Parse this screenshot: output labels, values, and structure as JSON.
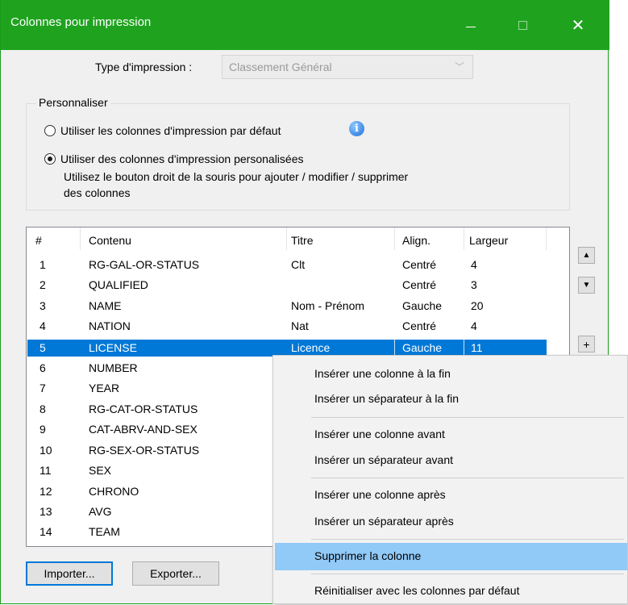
{
  "window": {
    "title": "Colonnes pour impression",
    "minimize_glyph": "—",
    "close_glyph": "✕"
  },
  "print_type": {
    "label": "Type d'impression :",
    "value": "Classement Général"
  },
  "personalize": {
    "legend": "Personnaliser",
    "option_default": "Utiliser les colonnes d'impression par défaut",
    "option_custom": "Utiliser des colonnes d'impression personalisées",
    "help_line1": "Utilisez le bouton droit de la souris pour ajouter / modifier / supprimer",
    "help_line2": "des colonnes",
    "selected": "custom"
  },
  "columns_list": {
    "headers": [
      "#",
      "Contenu",
      "Titre",
      "Align.",
      "Largeur"
    ],
    "rows": [
      {
        "num": "1",
        "contenu": "RG-GAL-OR-STATUS",
        "titre": "Clt",
        "align": "Centré",
        "largeur": "4"
      },
      {
        "num": "2",
        "contenu": "QUALIFIED",
        "titre": "",
        "align": "Centré",
        "largeur": "3"
      },
      {
        "num": "3",
        "contenu": "NAME",
        "titre": "Nom - Prénom",
        "align": "Gauche",
        "largeur": "20"
      },
      {
        "num": "4",
        "contenu": "NATION",
        "titre": "Nat",
        "align": "Centré",
        "largeur": "4"
      },
      {
        "num": "5",
        "contenu": "LICENSE",
        "titre": "Licence",
        "align": "Gauche",
        "largeur": "11"
      },
      {
        "num": "6",
        "contenu": "NUMBER",
        "titre": "",
        "align": "",
        "largeur": ""
      },
      {
        "num": "7",
        "contenu": "YEAR",
        "titre": "",
        "align": "",
        "largeur": ""
      },
      {
        "num": "8",
        "contenu": "RG-CAT-OR-STATUS",
        "titre": "",
        "align": "",
        "largeur": ""
      },
      {
        "num": "9",
        "contenu": "CAT-ABRV-AND-SEX",
        "titre": "",
        "align": "",
        "largeur": ""
      },
      {
        "num": "10",
        "contenu": "RG-SEX-OR-STATUS",
        "titre": "",
        "align": "",
        "largeur": ""
      },
      {
        "num": "11",
        "contenu": "SEX",
        "titre": "",
        "align": "",
        "largeur": ""
      },
      {
        "num": "12",
        "contenu": "CHRONO",
        "titre": "",
        "align": "",
        "largeur": ""
      },
      {
        "num": "13",
        "contenu": "AVG",
        "titre": "",
        "align": "",
        "largeur": ""
      },
      {
        "num": "14",
        "contenu": "TEAM",
        "titre": "",
        "align": "",
        "largeur": ""
      }
    ],
    "selected_row": "5"
  },
  "side_buttons": {
    "up_glyph": "▲",
    "down_glyph": "▼",
    "add_glyph": "+"
  },
  "buttons": {
    "import": "Importer...",
    "export": "Exporter..."
  },
  "context_menu": {
    "items": [
      "Insérer une colonne à la fin",
      "Insérer un séparateur à la fin",
      "Insérer une colonne avant",
      "Insérer un séparateur avant",
      "Insérer une colonne après",
      "Insérer un séparateur après",
      "Supprimer la colonne",
      "Réinitialiser avec les colonnes par défaut"
    ],
    "highlighted": "Supprimer la colonne"
  },
  "colors": {
    "titlebar": "#1fa31f",
    "selection": "#0078d7",
    "menu_highlight": "#91c9f7"
  }
}
